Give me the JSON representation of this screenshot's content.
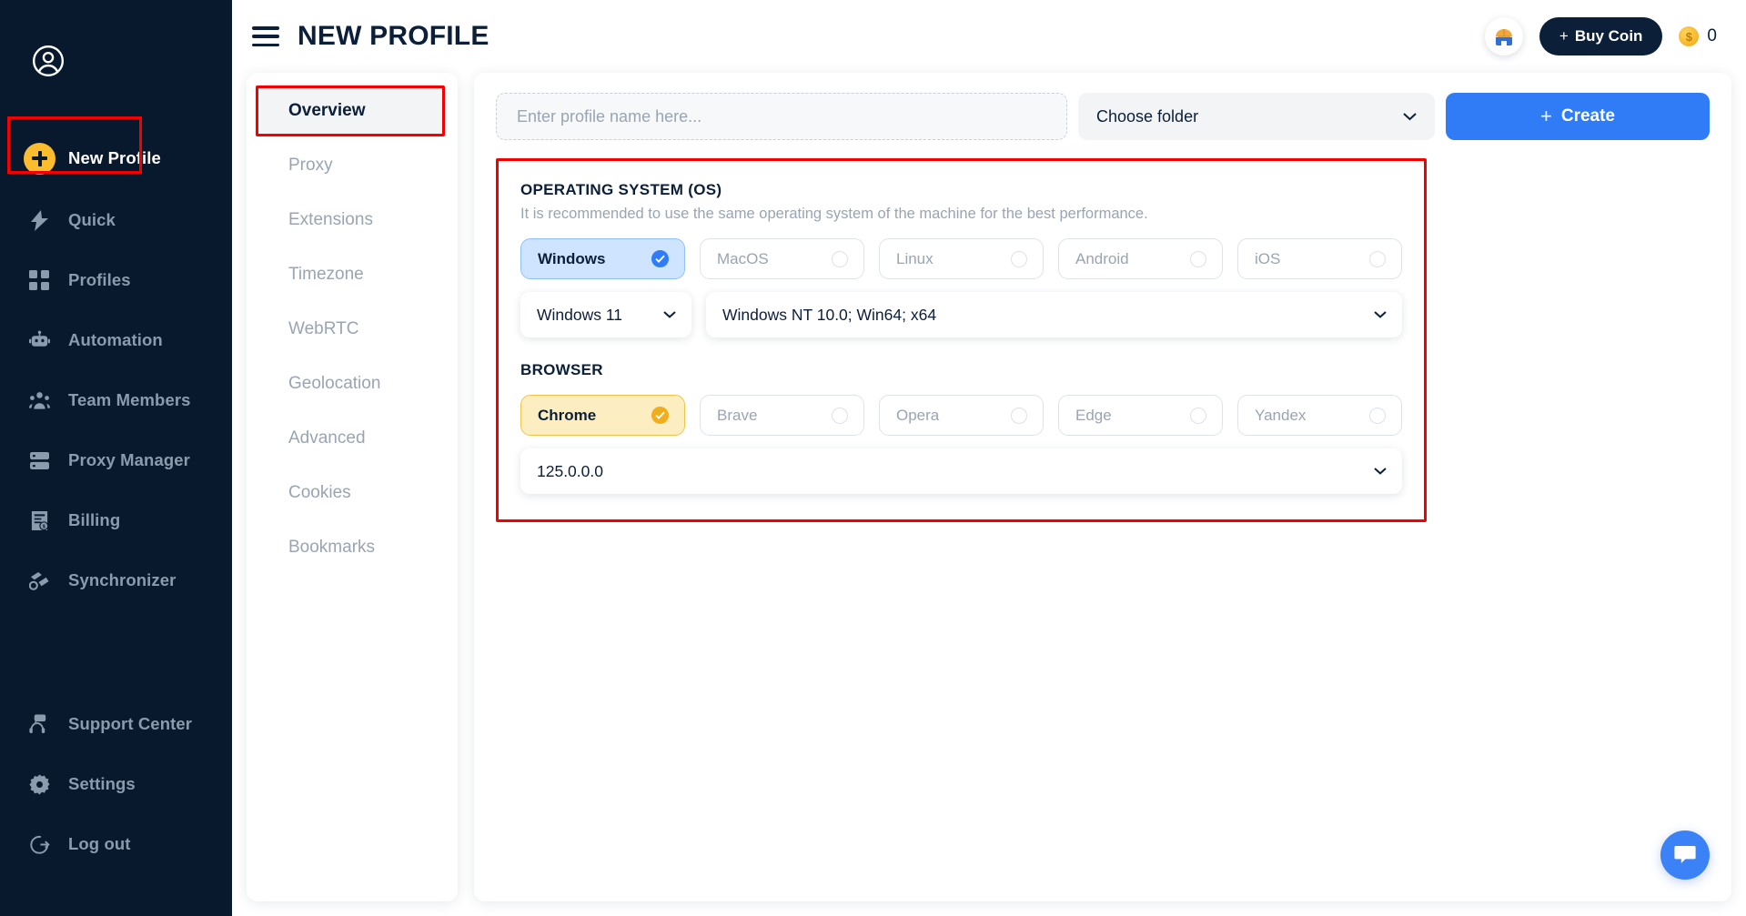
{
  "sidebar": {
    "avatar_icon": "user-circle-icon",
    "primary": {
      "label": "New Profile",
      "icon": "plus-circle-icon"
    },
    "items": [
      {
        "label": "Quick",
        "icon": "lightning-icon"
      },
      {
        "label": "Profiles",
        "icon": "grid-icon"
      },
      {
        "label": "Automation",
        "icon": "robot-icon"
      },
      {
        "label": "Team Members",
        "icon": "users-icon"
      },
      {
        "label": "Proxy Manager",
        "icon": "server-icon"
      },
      {
        "label": "Billing",
        "icon": "invoice-icon"
      },
      {
        "label": "Synchronizer",
        "icon": "sync-icon"
      }
    ],
    "bottom_items": [
      {
        "label": "Support Center",
        "icon": "headset-icon"
      },
      {
        "label": "Settings",
        "icon": "gear-icon"
      },
      {
        "label": "Log out",
        "icon": "logout-icon"
      }
    ]
  },
  "header": {
    "menu_icon": "hamburger-icon",
    "title": "NEW PROFILE",
    "flag_icon": "flag-icon",
    "buy_coin": {
      "plus": "+",
      "label": "Buy Coin"
    },
    "coin": {
      "icon": "coin-icon",
      "symbol": "$",
      "count": "0"
    }
  },
  "tabs": [
    {
      "label": "Overview",
      "active": true
    },
    {
      "label": "Proxy",
      "active": false
    },
    {
      "label": "Extensions",
      "active": false
    },
    {
      "label": "Timezone",
      "active": false
    },
    {
      "label": "WebRTC",
      "active": false
    },
    {
      "label": "Geolocation",
      "active": false
    },
    {
      "label": "Advanced",
      "active": false
    },
    {
      "label": "Cookies",
      "active": false
    },
    {
      "label": "Bookmarks",
      "active": false
    }
  ],
  "toolbar": {
    "profile_name_value": "",
    "profile_name_placeholder": "Enter profile name here...",
    "folder_select_value": "Choose folder",
    "create_plus": "+",
    "create_label": "Create"
  },
  "os_section": {
    "title": "OPERATING SYSTEM (OS)",
    "subtitle": "It is recommended to use the same operating system of the machine for the best performance.",
    "options": [
      {
        "label": "Windows",
        "selected": true
      },
      {
        "label": "MacOS",
        "selected": false
      },
      {
        "label": "Linux",
        "selected": false
      },
      {
        "label": "Android",
        "selected": false
      },
      {
        "label": "iOS",
        "selected": false
      }
    ],
    "version_value": "Windows 11",
    "useragent_value": "Windows NT 10.0; Win64; x64"
  },
  "browser_section": {
    "title": "BROWSER",
    "options": [
      {
        "label": "Chrome",
        "selected": true
      },
      {
        "label": "Brave",
        "selected": false
      },
      {
        "label": "Opera",
        "selected": false
      },
      {
        "label": "Edge",
        "selected": false
      },
      {
        "label": "Yandex",
        "selected": false
      }
    ],
    "version_value": "125.0.0.0"
  },
  "chat": {
    "icon": "chat-bubble-icon"
  },
  "colors": {
    "sidebar_bg": "#08192e",
    "accent_blue": "#2f7cf6",
    "accent_yellow": "#fbbc2d",
    "annotation_red": "#f40000",
    "selected_blue_bg": "#cfe4fe",
    "selected_yellow_bg": "#fdeec2",
    "text_dark": "#0b1f38",
    "text_muted": "#9aa4b2"
  }
}
